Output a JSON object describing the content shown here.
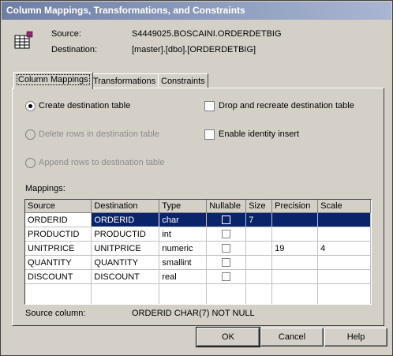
{
  "title": "Column Mappings, Transformations, and Constraints",
  "header": {
    "source_label": "Source:",
    "source_value": "S4449025.BOSCAINI.ORDERDETBIG",
    "destination_label": "Destination:",
    "destination_value": "[master].[dbo].[ORDERDETBIG]"
  },
  "tabs": [
    "Column Mappings",
    "Transformations",
    "Constraints"
  ],
  "options": {
    "create_table": "Create destination table",
    "delete_rows": "Delete rows in destination table",
    "append_rows": "Append rows to destination table",
    "drop_recreate": "Drop and recreate destination table",
    "identity_insert": "Enable identity insert"
  },
  "mappings_label": "Mappings:",
  "grid": {
    "columns": [
      "Source",
      "Destination",
      "Type",
      "Nullable",
      "Size",
      "Precision",
      "Scale"
    ],
    "rows": [
      {
        "source": "ORDERID",
        "destination": "ORDERID",
        "type": "char",
        "nullable": false,
        "size": "7",
        "precision": "",
        "scale": ""
      },
      {
        "source": "PRODUCTID",
        "destination": "PRODUCTID",
        "type": "int",
        "nullable": false,
        "size": "",
        "precision": "",
        "scale": ""
      },
      {
        "source": "UNITPRICE",
        "destination": "UNITPRICE",
        "type": "numeric",
        "nullable": false,
        "size": "",
        "precision": "19",
        "scale": "4"
      },
      {
        "source": "QUANTITY",
        "destination": "QUANTITY",
        "type": "smallint",
        "nullable": false,
        "size": "",
        "precision": "",
        "scale": ""
      },
      {
        "source": "DISCOUNT",
        "destination": "DISCOUNT",
        "type": "real",
        "nullable": false,
        "size": "",
        "precision": "",
        "scale": ""
      }
    ]
  },
  "source_column_label": "Source column:",
  "source_column_value": "ORDERID CHAR(7) NOT NULL",
  "buttons": {
    "ok": "OK",
    "cancel": "Cancel",
    "help": "Help"
  }
}
